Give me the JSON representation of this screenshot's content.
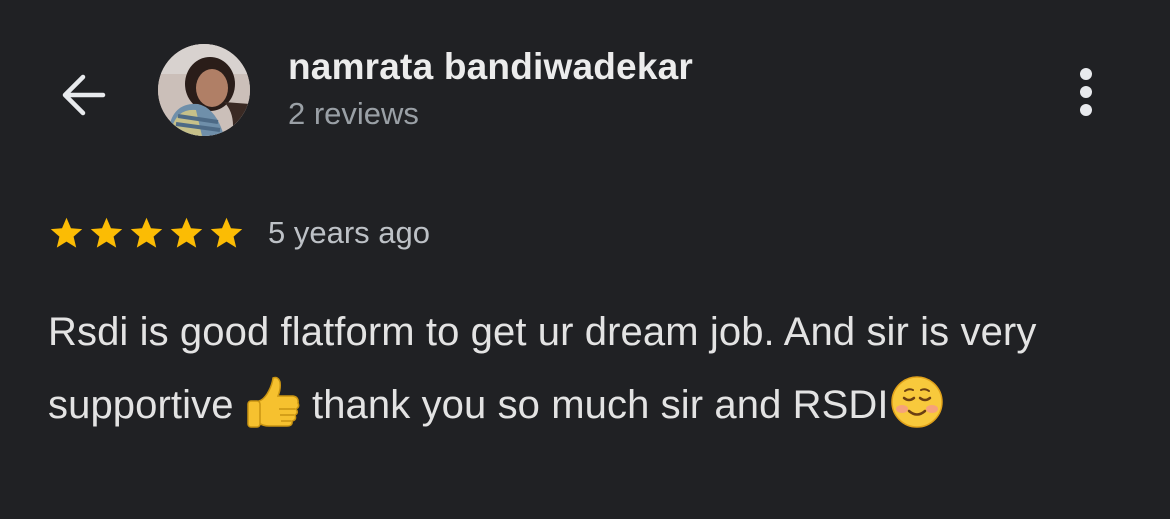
{
  "header": {
    "back_icon": "arrow-left-icon",
    "reviewer_name": "namrata bandiwadekar",
    "review_count": "2 reviews",
    "more_icon": "more-vertical-icon"
  },
  "review": {
    "rating": 5,
    "max_rating": 5,
    "star_color": "#fbbc04",
    "date": "5 years ago",
    "text_part1": "Rsdi is good flatform to get ur dream job. And sir is very supportive",
    "emoji1": "thumbs-up-emoji",
    "text_part2": "thank you so much sir and RSDI",
    "emoji2": "smiling-face-emoji"
  },
  "colors": {
    "background": "#202124",
    "primary_text": "#e8eaed",
    "secondary_text": "#9aa0a6"
  }
}
